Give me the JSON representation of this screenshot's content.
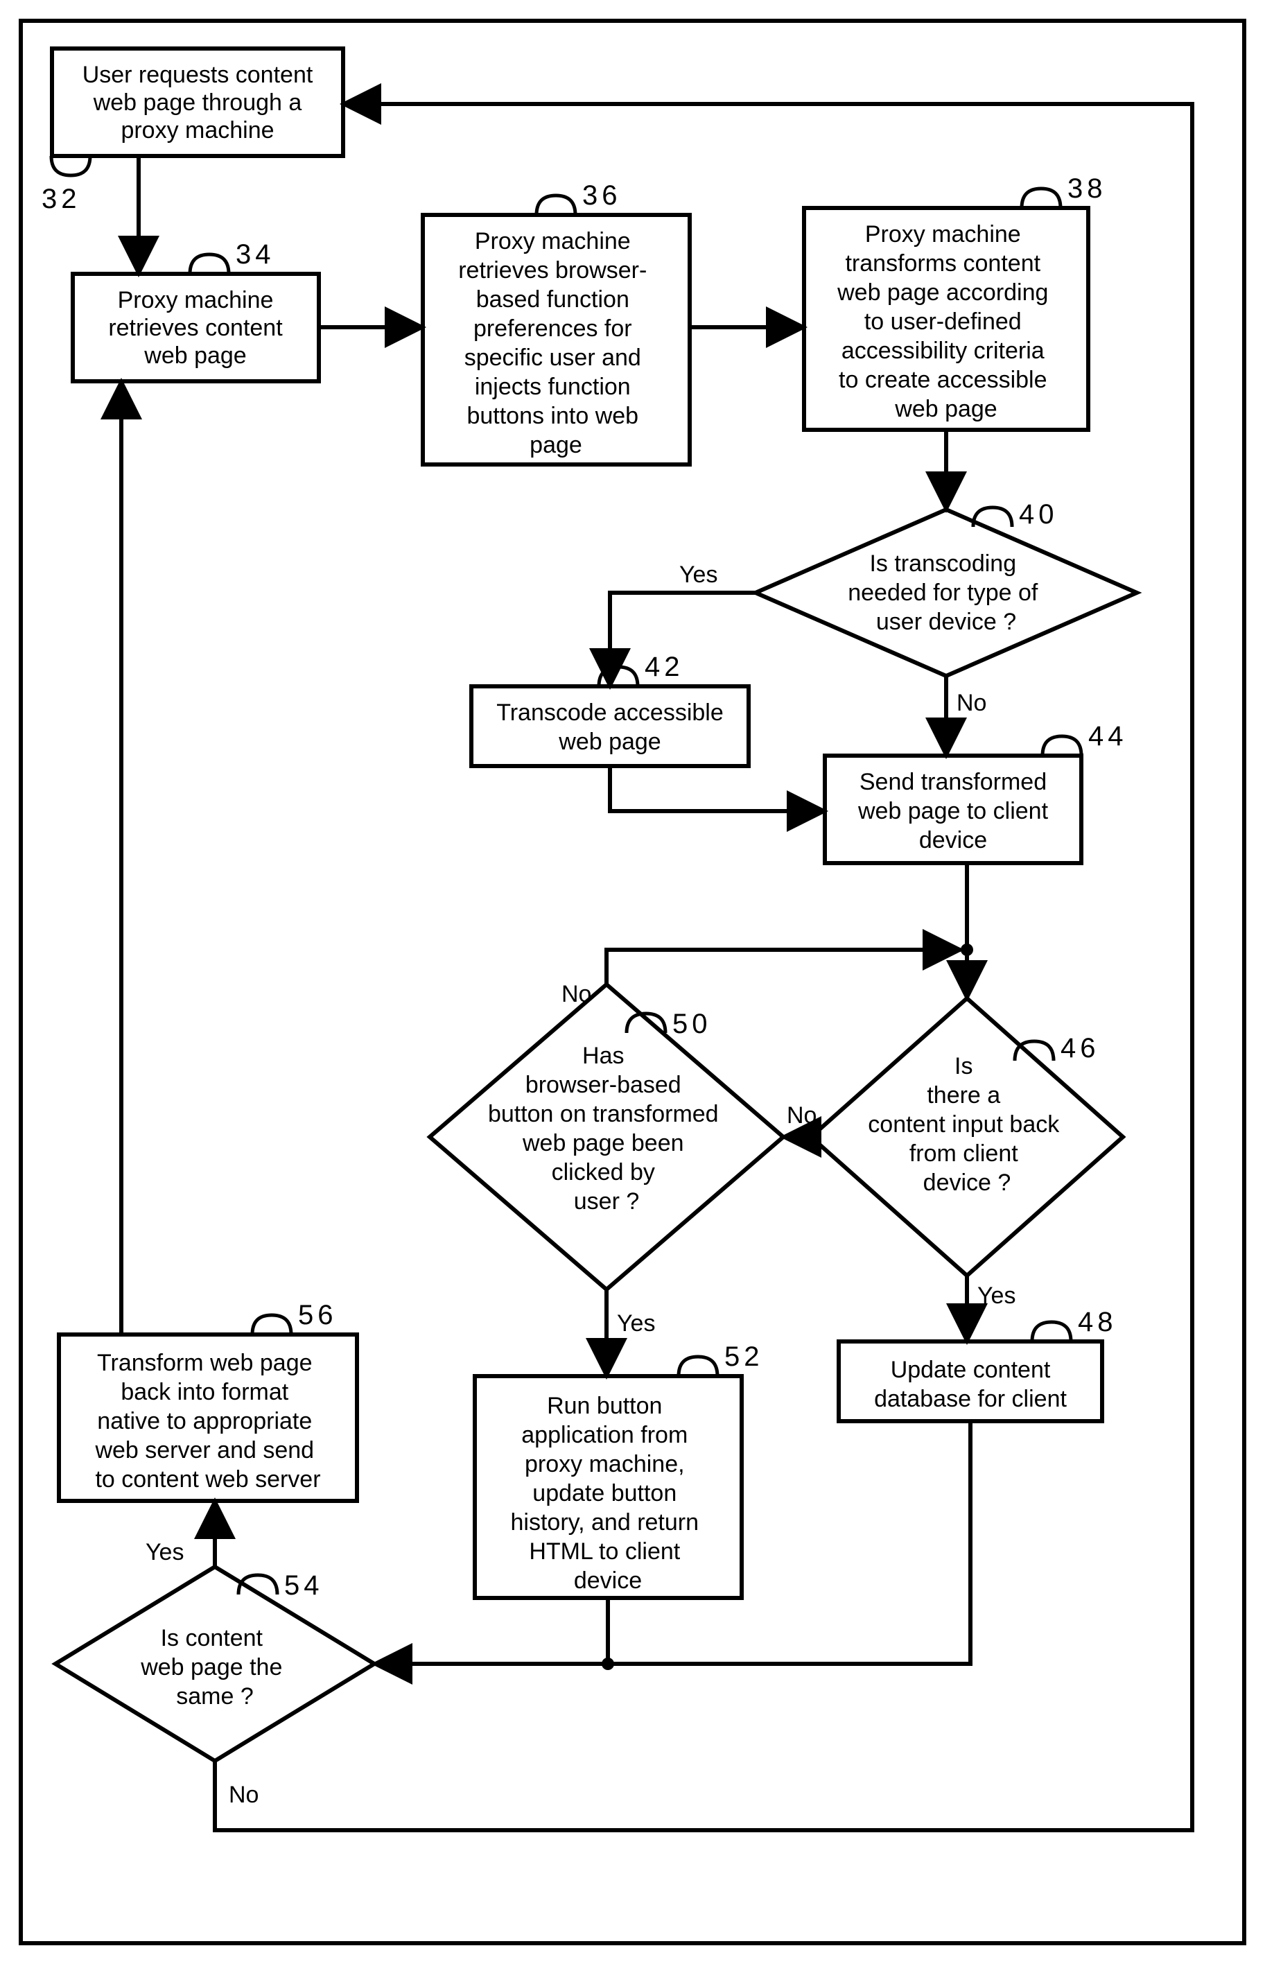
{
  "nodes": {
    "n32": {
      "num": "32",
      "lines": [
        "User requests content",
        "web page through a",
        "proxy machine"
      ]
    },
    "n34": {
      "num": "34",
      "lines": [
        "Proxy machine",
        "retrieves content",
        "web page"
      ]
    },
    "n36": {
      "num": "36",
      "lines": [
        "Proxy machine",
        "retrieves browser-",
        "based function",
        "preferences for",
        "specific user and",
        "injects function",
        "buttons into web",
        "page"
      ]
    },
    "n38": {
      "num": "38",
      "lines": [
        "Proxy machine",
        "transforms content",
        "web page according",
        "to user-defined",
        "accessibility criteria",
        "to create accessible",
        "web page"
      ]
    },
    "n40": {
      "num": "40",
      "lines": [
        "Is transcoding",
        "needed for type of",
        "user device ?"
      ]
    },
    "n42": {
      "num": "42",
      "lines": [
        "Transcode accessible",
        "web page"
      ]
    },
    "n44": {
      "num": "44",
      "lines": [
        "Send transformed",
        "web page to client",
        "device"
      ]
    },
    "n46": {
      "num": "46",
      "lines": [
        "Is",
        "there a",
        "content input back",
        "from client",
        "device ?"
      ]
    },
    "n48": {
      "num": "48",
      "lines": [
        "Update content",
        "database for client"
      ]
    },
    "n50": {
      "num": "50",
      "lines": [
        "Has",
        "browser-based",
        "button on transformed",
        "web page been",
        "clicked by",
        "user ?"
      ]
    },
    "n52": {
      "num": "52",
      "lines": [
        "Run button",
        "application from",
        "proxy machine,",
        "update button",
        "history, and return",
        "HTML to client",
        "device"
      ]
    },
    "n54": {
      "num": "54",
      "lines": [
        "Is content",
        "web page the",
        "same ?"
      ]
    },
    "n56": {
      "num": "56",
      "lines": [
        "Transform web page",
        "back into format",
        "native to appropriate",
        "web server and send",
        "to content web server"
      ]
    }
  },
  "edgeLabels": {
    "yes": "Yes",
    "no": "No"
  }
}
